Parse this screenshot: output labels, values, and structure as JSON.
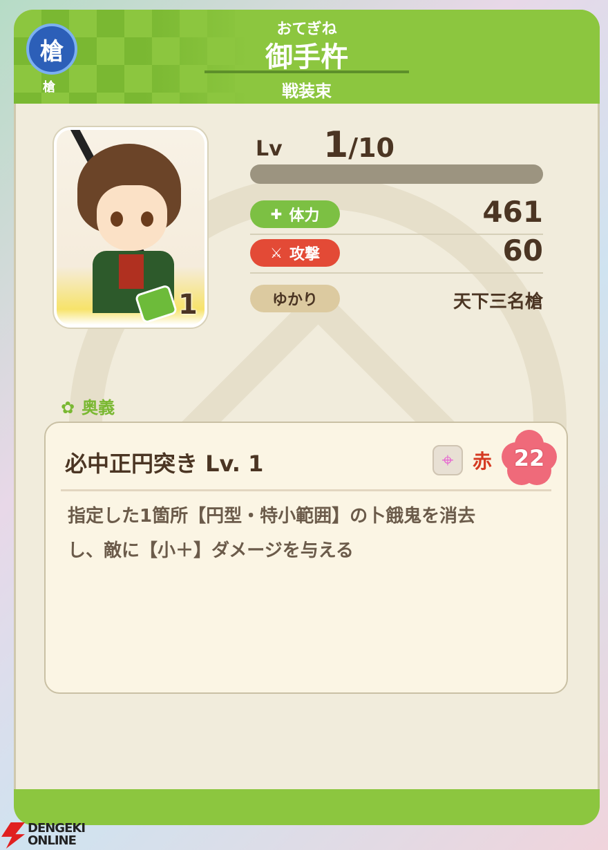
{
  "header": {
    "weapon_icon_char": "槍",
    "weapon_label": "槍",
    "reading": "おてぎね",
    "name": "御手杵",
    "costume": "戦装束"
  },
  "portrait": {
    "item_count": "1"
  },
  "level": {
    "label": "Lv",
    "current": "1",
    "max": "/10",
    "progress": 0
  },
  "stats": {
    "hp_label": "体力",
    "hp_value": "461",
    "atk_label": "攻撃",
    "atk_value": "60",
    "yukari_label": "ゆかり",
    "yukari_value": "天下三名槍"
  },
  "skill": {
    "section_label": "奥義",
    "name": "必中正円突き Lv. 1",
    "color_label": "赤",
    "cost": "22",
    "description_line1": "指定した1箇所【円型・特小範囲】の卜餓鬼を消去",
    "description_line2": "し、敵に【小＋】ダメージを与える"
  },
  "watermark": {
    "line1": "DENGEKI",
    "line2": "ONLINE"
  },
  "colors": {
    "accent_green": "#8cc63f",
    "hp_green": "#7cc043",
    "atk_red": "#e34a36",
    "text_brown": "#4b3523"
  }
}
